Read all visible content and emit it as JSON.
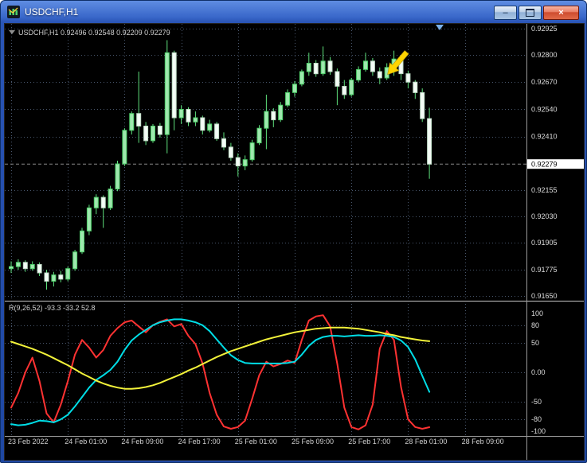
{
  "window": {
    "title": "USDCHF,H1",
    "controls": {
      "minimize_glyph": "–",
      "close_glyph": "×"
    }
  },
  "chart_data": [
    {
      "type": "candlestick",
      "title": "USDCHF,H1",
      "ohlc_label": "USDCHF,H1 0.92496 0.92548 0.92209 0.92279",
      "current_price": {
        "label": "0.92279",
        "value": 0.92279
      },
      "y_axis": {
        "range": [
          0.9165,
          0.92925
        ],
        "ticks": [
          {
            "label": "0.92925",
            "value": 0.92925
          },
          {
            "label": "0.92800",
            "value": 0.928
          },
          {
            "label": "0.92670",
            "value": 0.9267
          },
          {
            "label": "0.92540",
            "value": 0.9254
          },
          {
            "label": "0.92410",
            "value": 0.9241
          },
          {
            "label": "0.92155",
            "value": 0.92155
          },
          {
            "label": "0.92030",
            "value": 0.9203
          },
          {
            "label": "0.91905",
            "value": 0.91905
          },
          {
            "label": "0.91775",
            "value": 0.91775
          },
          {
            "label": "0.91650",
            "value": 0.9165
          }
        ]
      },
      "x_axis": {
        "tick_indices": [
          0,
          8,
          16,
          24,
          32,
          40,
          48,
          56,
          64
        ],
        "tick_labels": [
          "23 Feb 2022",
          "24 Feb 01:00",
          "24 Feb 09:00",
          "24 Feb 17:00",
          "25 Feb 01:00",
          "25 Feb 09:00",
          "25 Feb 17:00",
          "28 Feb 01:00",
          "28 Feb 09:00"
        ]
      },
      "colors": {
        "up": "#9fe8ae",
        "up_border": "#4ed06a",
        "down": "#f4fcf6",
        "down_border": "#bfdcc6",
        "wick": "#5ee07c"
      },
      "candles": [
        [
          0.9178,
          0.91815,
          0.9176,
          0.9179
        ],
        [
          0.9179,
          0.91825,
          0.91775,
          0.9181
        ],
        [
          0.9181,
          0.9182,
          0.91765,
          0.9178
        ],
        [
          0.9178,
          0.91815,
          0.9177,
          0.918
        ],
        [
          0.918,
          0.9181,
          0.91745,
          0.9176
        ],
        [
          0.9176,
          0.91775,
          0.9168,
          0.9172
        ],
        [
          0.9172,
          0.91765,
          0.91695,
          0.9175
        ],
        [
          0.9175,
          0.9177,
          0.91715,
          0.9173
        ],
        [
          0.9173,
          0.9179,
          0.9172,
          0.9178
        ],
        [
          0.9178,
          0.9187,
          0.9177,
          0.9186
        ],
        [
          0.9186,
          0.91975,
          0.9185,
          0.9196
        ],
        [
          0.9196,
          0.92085,
          0.9194,
          0.9207
        ],
        [
          0.9207,
          0.92135,
          0.9204,
          0.9212
        ],
        [
          0.9212,
          0.9213,
          0.91975,
          0.9207
        ],
        [
          0.9207,
          0.92175,
          0.9206,
          0.9216
        ],
        [
          0.9216,
          0.92295,
          0.9215,
          0.9228
        ],
        [
          0.9228,
          0.9245,
          0.9227,
          0.9244
        ],
        [
          0.9244,
          0.9253,
          0.9242,
          0.9252
        ],
        [
          0.9252,
          0.9272,
          0.9238,
          0.9246
        ],
        [
          0.9246,
          0.9248,
          0.9237,
          0.9239
        ],
        [
          0.9239,
          0.9247,
          0.9238,
          0.9246
        ],
        [
          0.9246,
          0.92475,
          0.92405,
          0.9242
        ],
        [
          0.9242,
          0.9287,
          0.9233,
          0.9281
        ],
        [
          0.9281,
          0.9282,
          0.9244,
          0.925
        ],
        [
          0.925,
          0.9256,
          0.9247,
          0.9254
        ],
        [
          0.9254,
          0.9255,
          0.9246,
          0.9248
        ],
        [
          0.9248,
          0.9253,
          0.9246,
          0.925
        ],
        [
          0.925,
          0.9251,
          0.9242,
          0.9244
        ],
        [
          0.9244,
          0.9249,
          0.9243,
          0.9247
        ],
        [
          0.9247,
          0.9248,
          0.9239,
          0.924
        ],
        [
          0.924,
          0.9243,
          0.92345,
          0.9236
        ],
        [
          0.9236,
          0.9238,
          0.92295,
          0.9231
        ],
        [
          0.9231,
          0.9233,
          0.9222,
          0.9227
        ],
        [
          0.9227,
          0.9232,
          0.9225,
          0.923
        ],
        [
          0.923,
          0.92395,
          0.9229,
          0.9238
        ],
        [
          0.9238,
          0.92465,
          0.9237,
          0.9245
        ],
        [
          0.9245,
          0.9261,
          0.9235,
          0.9253
        ],
        [
          0.9253,
          0.92545,
          0.92455,
          0.9249
        ],
        [
          0.9249,
          0.92575,
          0.9248,
          0.9256
        ],
        [
          0.9256,
          0.92635,
          0.9255,
          0.9262
        ],
        [
          0.9262,
          0.92675,
          0.926,
          0.9266
        ],
        [
          0.9266,
          0.9273,
          0.9265,
          0.9272
        ],
        [
          0.9272,
          0.9281,
          0.927,
          0.9276
        ],
        [
          0.9276,
          0.92775,
          0.92695,
          0.9271
        ],
        [
          0.9271,
          0.9284,
          0.927,
          0.9277
        ],
        [
          0.9277,
          0.9279,
          0.92705,
          0.9272
        ],
        [
          0.9272,
          0.92735,
          0.9256,
          0.9265
        ],
        [
          0.9265,
          0.9268,
          0.9259,
          0.9261
        ],
        [
          0.9261,
          0.9269,
          0.926,
          0.9268
        ],
        [
          0.9268,
          0.92745,
          0.9267,
          0.9273
        ],
        [
          0.9273,
          0.9281,
          0.9272,
          0.9277
        ],
        [
          0.9277,
          0.92785,
          0.927,
          0.9272
        ],
        [
          0.9272,
          0.9274,
          0.9266,
          0.9269
        ],
        [
          0.9269,
          0.9276,
          0.9268,
          0.9274
        ],
        [
          0.9274,
          0.9282,
          0.927,
          0.9278
        ],
        [
          0.9278,
          0.9279,
          0.9268,
          0.9271
        ],
        [
          0.9271,
          0.92725,
          0.9264,
          0.9267
        ],
        [
          0.9267,
          0.9268,
          0.9259,
          0.9262
        ],
        [
          0.9262,
          0.9264,
          0.9248,
          0.92496
        ],
        [
          0.92496,
          0.92548,
          0.92209,
          0.92279
        ]
      ],
      "annotations": [
        {
          "type": "down-left-arrow",
          "candle_index": 54,
          "anchor_price": 0.9282,
          "color": "#ffd400"
        }
      ]
    },
    {
      "type": "line",
      "label": "R(9,26,52) -93.3 -33.2 52.8",
      "range": [
        -100,
        100
      ],
      "levels": [
        80,
        50,
        0,
        -50,
        -80
      ],
      "ticks": [
        {
          "label": "100",
          "value": 100
        },
        {
          "label": "80",
          "value": 80
        },
        {
          "label": "50",
          "value": 50
        },
        {
          "label": "0.00",
          "value": 0
        },
        {
          "label": "-50",
          "value": -50
        },
        {
          "label": "-80",
          "value": -80
        },
        {
          "label": "-100",
          "value": -100
        }
      ],
      "series": [
        {
          "name": "fast-red",
          "color": "#ff3232",
          "values": [
            -60,
            -35,
            0,
            25,
            -15,
            -70,
            -85,
            -55,
            -15,
            30,
            55,
            42,
            25,
            38,
            62,
            75,
            85,
            88,
            78,
            68,
            80,
            86,
            90,
            78,
            82,
            62,
            48,
            15,
            -35,
            -72,
            -92,
            -96,
            -93,
            -82,
            -45,
            -5,
            18,
            10,
            14,
            20,
            16,
            55,
            88,
            95,
            97,
            78,
            15,
            -60,
            -93,
            -97,
            -90,
            -55,
            40,
            70,
            55,
            -25,
            -80,
            -93,
            -96,
            -93.3
          ]
        },
        {
          "name": "medium-cyan",
          "color": "#00dde6",
          "values": [
            -88,
            -90,
            -89,
            -86,
            -82,
            -83,
            -85,
            -80,
            -72,
            -58,
            -42,
            -26,
            -13,
            -5,
            4,
            18,
            38,
            54,
            64,
            72,
            80,
            85,
            88,
            90,
            90,
            88,
            85,
            80,
            70,
            56,
            42,
            29,
            21,
            16,
            15,
            15,
            15,
            15,
            15,
            16,
            18,
            30,
            45,
            55,
            60,
            62,
            62,
            61,
            62,
            63,
            62,
            62,
            63,
            62,
            60,
            54,
            43,
            22,
            -6,
            -33.2
          ]
        },
        {
          "name": "slow-yellow",
          "color": "#f2f23a",
          "values": [
            52,
            48,
            44,
            40,
            35,
            30,
            24,
            18,
            12,
            5,
            -2,
            -8,
            -14,
            -19,
            -23,
            -26,
            -28,
            -28,
            -27,
            -25,
            -22,
            -18,
            -13,
            -8,
            -3,
            3,
            8,
            14,
            20,
            26,
            31,
            36,
            40,
            44,
            48,
            52,
            56,
            59,
            62,
            65,
            68,
            70,
            72,
            74,
            75,
            76,
            76,
            76,
            75,
            74,
            72,
            70,
            68,
            65,
            63,
            60,
            58,
            56,
            54,
            52.8
          ]
        }
      ]
    }
  ]
}
